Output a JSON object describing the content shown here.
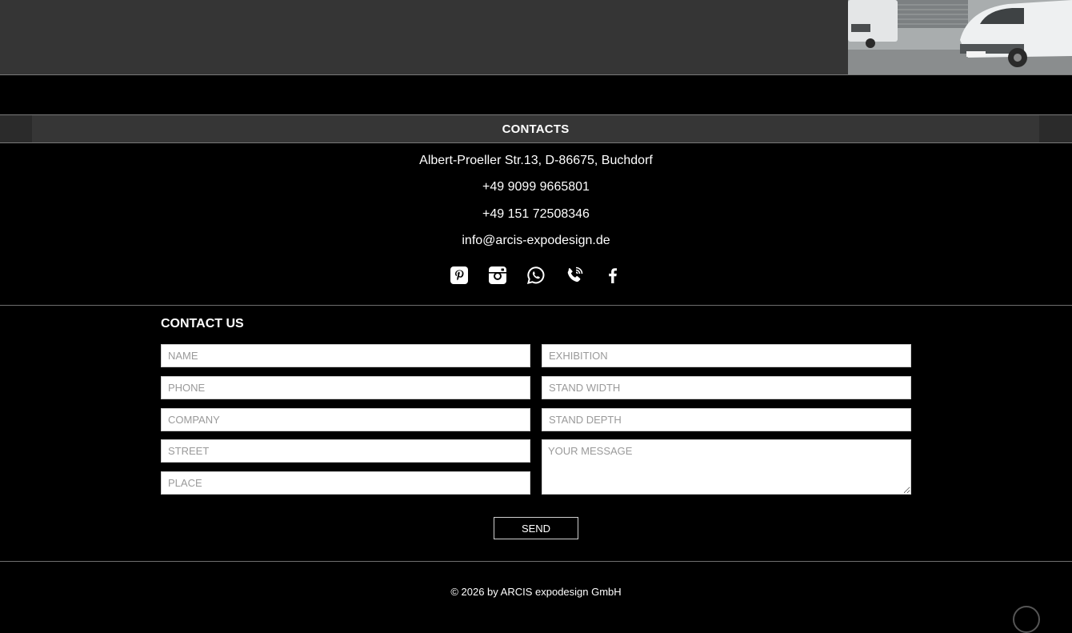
{
  "contacts": {
    "title": "CONTACTS",
    "address": "Albert-Proeller Str.13, D-86675, Buchdorf",
    "phone1": "+49 9099 9665801",
    "phone2": "+49 151 72508346",
    "email": "info@arcis-expodesign.de",
    "social_icons": [
      "pinterest-icon",
      "instagram-icon",
      "whatsapp-icon",
      "phone-icon",
      "facebook-icon"
    ]
  },
  "form": {
    "title": "CONTACT US",
    "name_placeholder": "NAME",
    "phone_placeholder": "PHONE",
    "company_placeholder": "COMPANY",
    "street_placeholder": "STREET",
    "place_placeholder": "PLACE",
    "exhibition_placeholder": "EXHIBITION",
    "stand_width_placeholder": "STAND WIDTH",
    "stand_depth_placeholder": "STAND DEPTH",
    "message_placeholder": "YOUR MESSAGE",
    "send_label": "SEND"
  },
  "footer": {
    "copyright": "© 2026 by ARCIS expodesign GmbH"
  },
  "colors": {
    "background": "#000000",
    "band": "#353535",
    "text": "#ffffff"
  }
}
